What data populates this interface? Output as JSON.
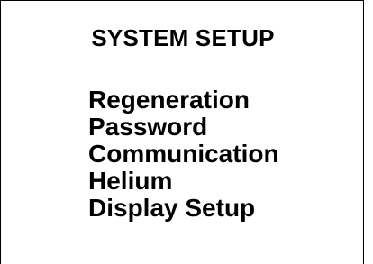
{
  "screen": {
    "title": "SYSTEM SETUP"
  },
  "menu": {
    "items": [
      {
        "label": "Regeneration"
      },
      {
        "label": "Password"
      },
      {
        "label": "Communication"
      },
      {
        "label": "Helium"
      },
      {
        "label": "Display Setup"
      }
    ]
  },
  "colors": {
    "background": "#ffffff",
    "text": "#000000",
    "border": "#000000"
  }
}
